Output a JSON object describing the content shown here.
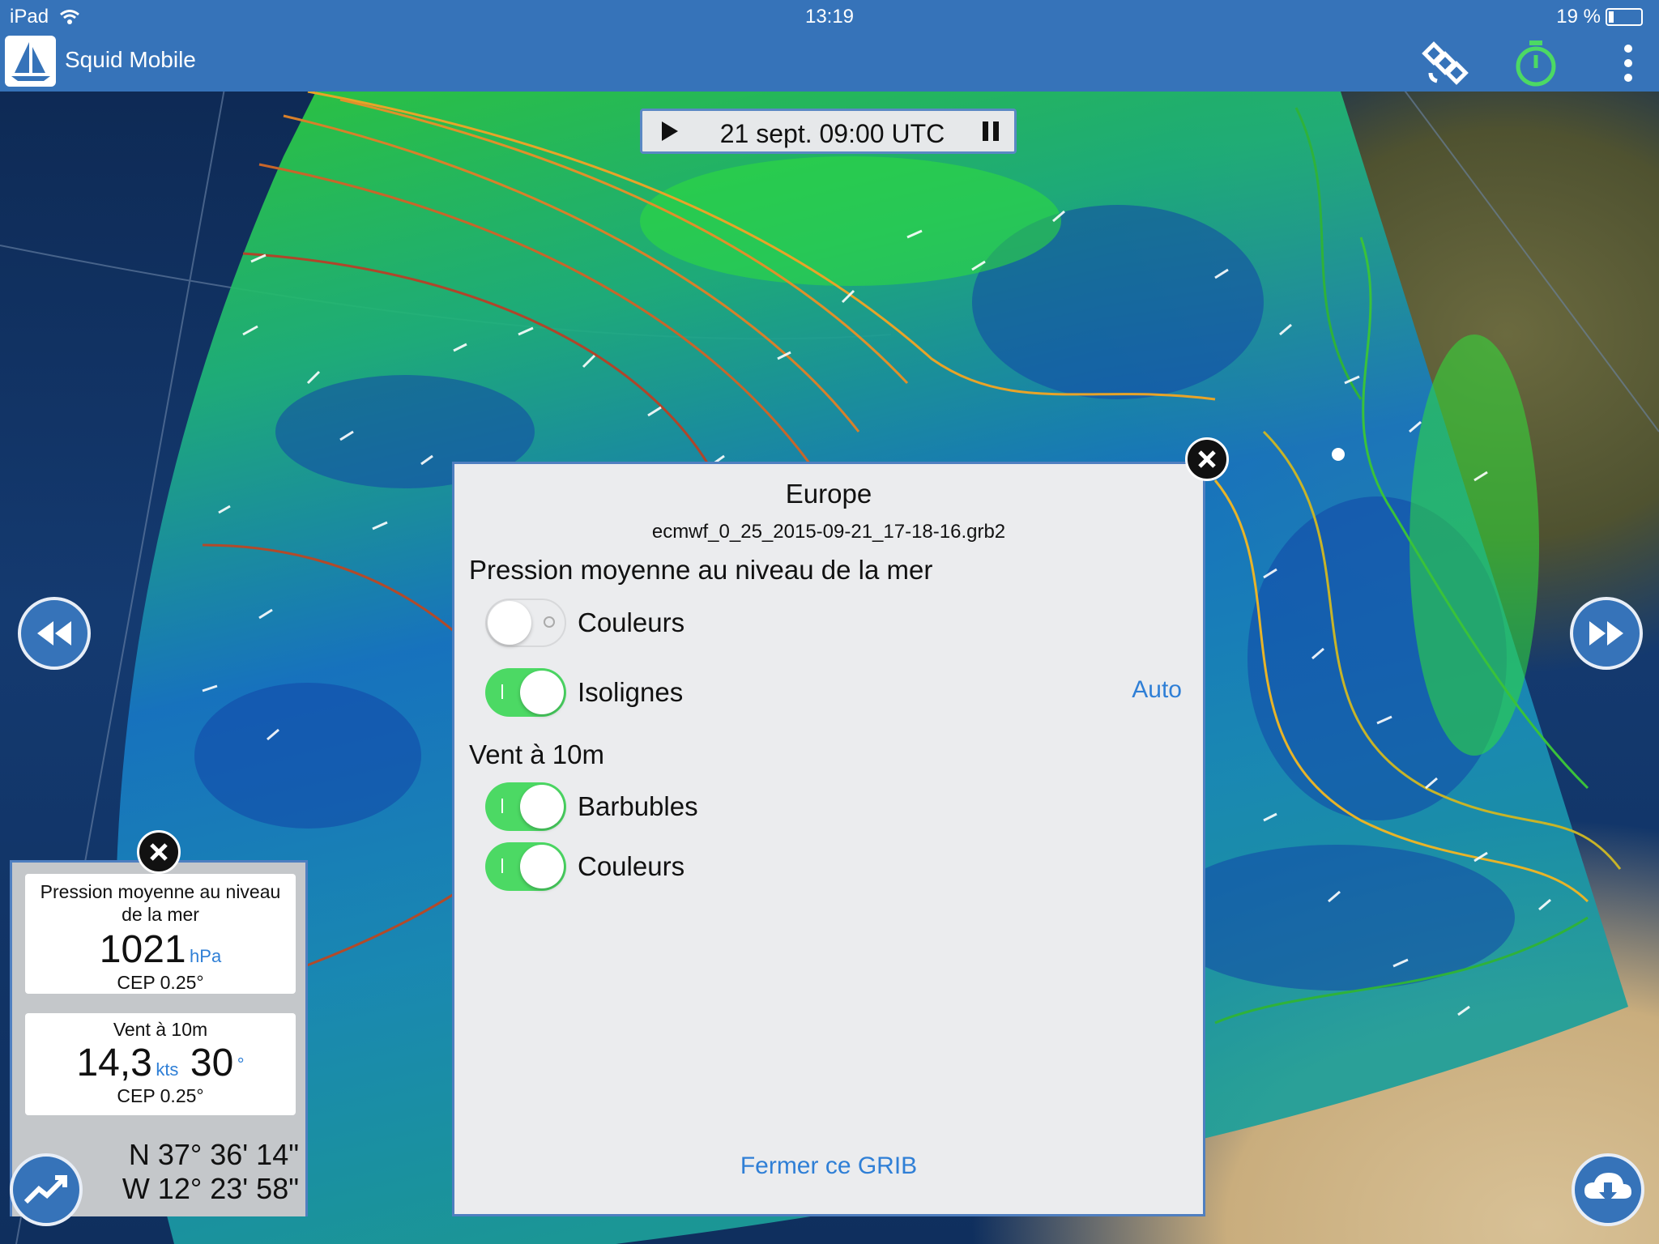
{
  "status_bar": {
    "device": "iPad",
    "time": "13:19",
    "battery": "19 %"
  },
  "app_bar": {
    "title": "Squid Mobile",
    "icons": [
      "satellite-icon",
      "timer-icon",
      "more-vertical-icon"
    ]
  },
  "timebar": {
    "time": "21 sept. 09:00 UTC"
  },
  "dialog": {
    "title": "Europe",
    "file": "ecmwf_0_25_2015-09-21_17-18-16.grb2",
    "section1": "Pression moyenne au niveau de la mer",
    "row_couleurs1": "Couleurs",
    "row_isolignes": "Isolignes",
    "auto": "Auto",
    "section2": "Vent à 10m",
    "row_barbubles": "Barbubles",
    "row_couleurs2": "Couleurs",
    "close": "Fermer ce GRIB",
    "toggles": {
      "couleurs1": false,
      "isolignes": true,
      "barbubles": true,
      "couleurs2": true
    }
  },
  "info": {
    "pressure": {
      "title": "Pression moyenne au niveau de la mer",
      "value": "1021",
      "unit": "hPa",
      "source": "CEP 0.25°"
    },
    "wind": {
      "title": "Vent à 10m",
      "speed": "14,3",
      "speed_unit": "kts",
      "direction": "30",
      "direction_unit": "°",
      "source": "CEP 0.25°"
    },
    "lat": "N 37° 36' 14\"",
    "lon": "W 12° 23' 58\""
  },
  "colors": {
    "accent": "#3673b9",
    "link": "#2f7fd6",
    "toggle_on": "#4cd964"
  }
}
